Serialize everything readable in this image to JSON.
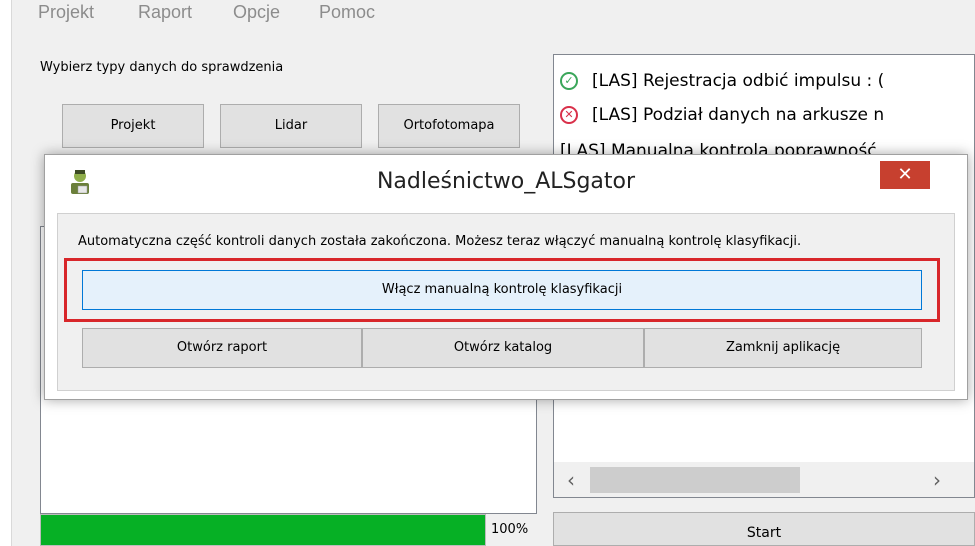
{
  "menu": {
    "items": [
      "Projekt",
      "Raport",
      "Opcje",
      "Pomoc"
    ]
  },
  "main": {
    "select_label": "Wybierz typy danych do sprawdzenia",
    "buttons": {
      "projekt": "Projekt",
      "lidar": "Lidar",
      "ortofotomapa": "Ortofotomapa"
    },
    "progress": {
      "value": 100,
      "label": "100%",
      "fill_color": "#06b025"
    },
    "start_label": "Start"
  },
  "log": {
    "entries": [
      {
        "status": "ok",
        "icon": "check-circle-icon",
        "text": "[LAS] Rejestracja odbić impulsu : ("
      },
      {
        "status": "error",
        "icon": "x-circle-icon",
        "text": "[LAS] Podział danych na arkusze n"
      },
      {
        "status": "none",
        "icon": "",
        "text": "[LAS] Manualna kontrola poprawność"
      }
    ]
  },
  "dialog": {
    "title": "Nadleśnictwo_ALSgator",
    "close_label": "✕",
    "message": "Automatyczna część kontroli danych została zakończona. Możesz teraz włączyć manualną kontrolę klasyfikacji.",
    "manual_button": "Włącz manualną kontrolę klasyfikacji",
    "buttons": {
      "open_report": "Otwórz raport",
      "open_folder": "Otwórz katalog",
      "close_app": "Zamknij aplikację"
    },
    "highlight_color": "#d8262a",
    "close_color": "#c7402f"
  },
  "icons": {
    "ok": "✓",
    "error": "✕",
    "scroll_left": "‹",
    "scroll_right": "›"
  }
}
